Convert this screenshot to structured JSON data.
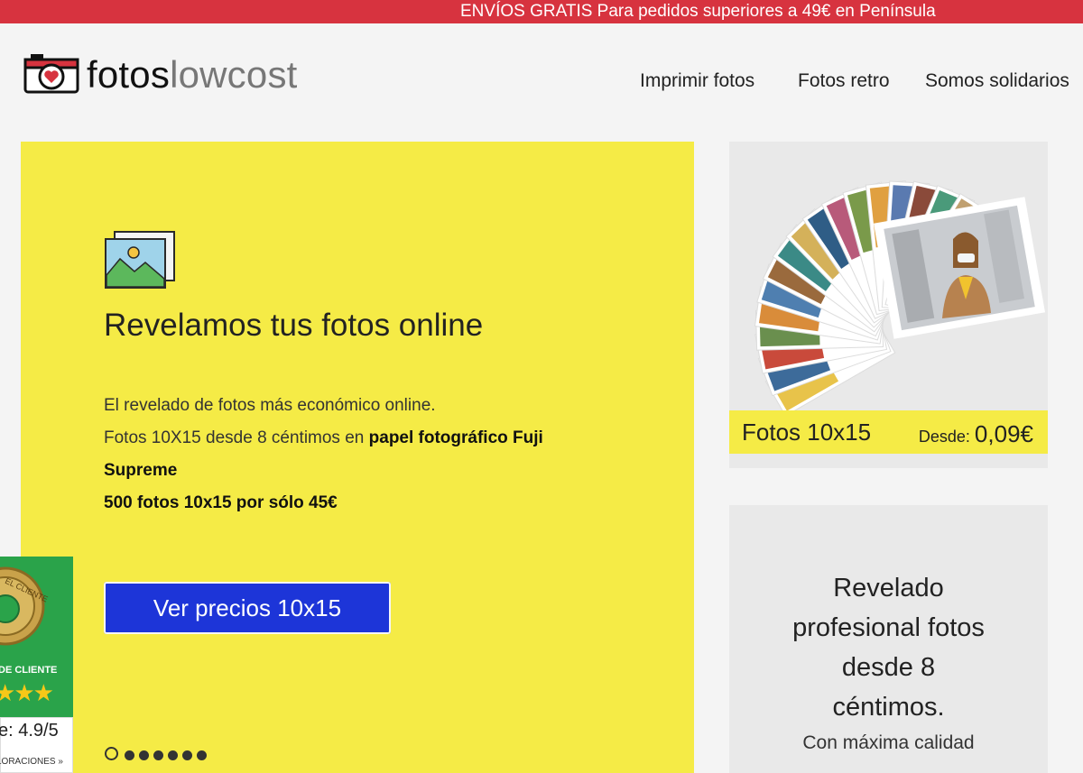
{
  "topbar": {
    "text": "ENVÍOS GRATIS Para pedidos superiores a 49€ en Península"
  },
  "logo": {
    "part1": "fotos",
    "part2": "lowcost",
    "icon": "camera-heart-icon"
  },
  "nav": [
    {
      "label": "Imprimir fotos"
    },
    {
      "label": "Fotos retro"
    },
    {
      "label": "Somos solidarios"
    }
  ],
  "hero": {
    "icon": "picture-stack-icon",
    "title": "Revelamos tus fotos online",
    "line1": "El revelado de fotos más económico online.",
    "line2_prefix": "Fotos 10X15 desde 8 céntimos en ",
    "line2_bold": "papel fotográfico Fuji",
    "line3_bold": "Supreme",
    "line4_bold": "500 fotos 10x15 por sólo 45€",
    "cta": "Ver precios 10x15",
    "slides_total": 7,
    "slide_active": 1
  },
  "product_card": {
    "title": "Fotos 10x15",
    "from_label": "Desde:",
    "price": "0,09€"
  },
  "promo_card": {
    "headline_lines": [
      "Revelado",
      "profesional fotos",
      "desde 8",
      "céntimos."
    ],
    "sub": "Con máxima calidad"
  },
  "rating_badge": {
    "label": "DE CLIENTE",
    "seal_text": "EL CLIENTE",
    "score": "e: 4.9/5",
    "count": "LORACIONES »",
    "colors": {
      "green": "#2aa34a",
      "star": "#f6c818"
    }
  },
  "colors": {
    "accent_red": "#d7333f",
    "hero_yellow": "#f5eb46",
    "cta_blue": "#1d35d8"
  }
}
